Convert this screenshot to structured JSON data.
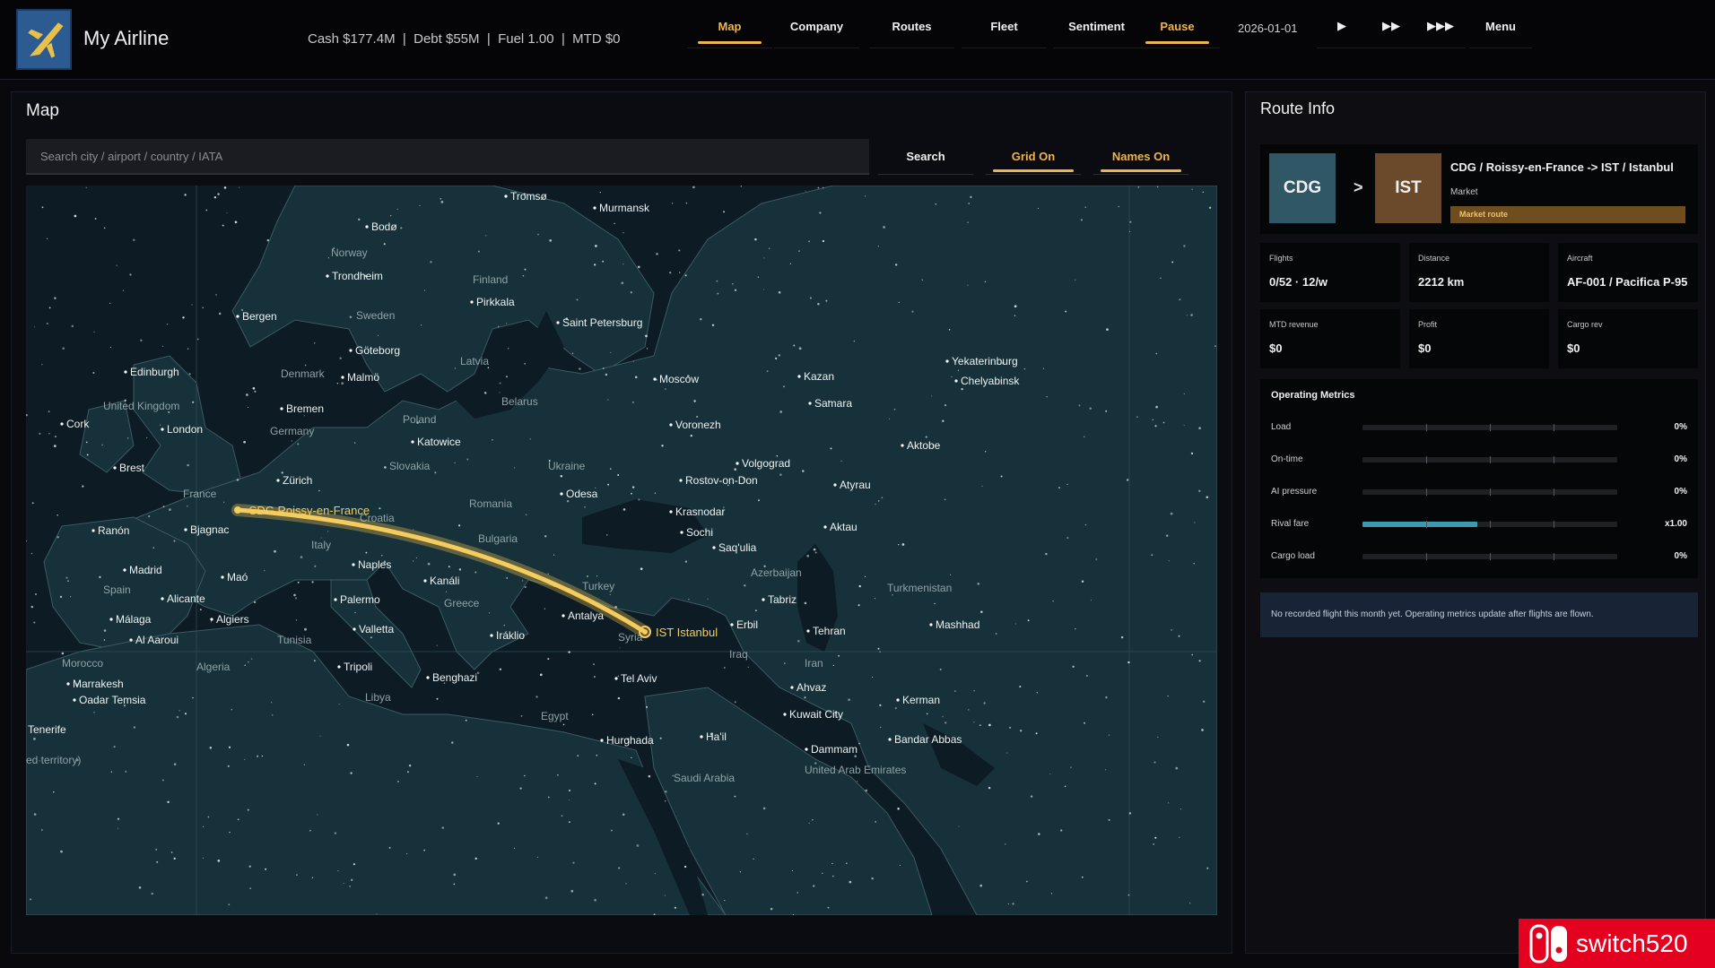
{
  "header": {
    "title": "My Airline",
    "stats": "Cash $177.4M  |  Debt $55M  |  Fuel 1.00  |  MTD $0",
    "nav": [
      {
        "label": "Map",
        "active": true
      },
      {
        "label": "Company",
        "active": false
      },
      {
        "label": "Routes",
        "active": false
      },
      {
        "label": "Fleet",
        "active": false
      },
      {
        "label": "Sentiment",
        "active": false
      },
      {
        "label": "Pause",
        "active": true
      }
    ],
    "date": "2026-01-01",
    "speed": [
      "▶",
      "▶▶",
      "▶▶▶"
    ],
    "menu": "Menu"
  },
  "map": {
    "title": "Map",
    "search_placeholder": "Search city / airport / country / IATA",
    "search_button": "Search",
    "grid_button": "Grid On",
    "names_button": "Names On",
    "cities": [
      "Tromsø",
      "Murmansk",
      "Bodø",
      "Trondheim",
      "Bergen",
      "Pirkkala",
      "Saint Petersburg",
      "Göteborg",
      "Edinburgh",
      "Malmö",
      "Moscow",
      "Kazan",
      "Yekaterinburg",
      "Chelyabinsk",
      "Samara",
      "Cork",
      "London",
      "Bremen",
      "Katowice",
      "Voronezh",
      "Aktobe",
      "Brest",
      "Zürich",
      "Volgograd",
      "Rostov-on-Don",
      "Atyrau",
      "Odesa",
      "Krasnodar",
      "Ranón",
      "Bjagnac",
      "Sochi",
      "Aktau",
      "Madrid",
      "Naples",
      "Saq'ulia",
      "Maó",
      "Kanáli",
      "Alicante",
      "Palermo",
      "Antalya",
      "Tabriz",
      "Málaga",
      "Algiers",
      "Valletta",
      "Erbil",
      "Tehran",
      "Mashhad",
      "Al Aaroui",
      "Iráklio",
      "Marrakesh",
      "Tripoli",
      "Benghazi",
      "Tel Aviv",
      "Ahvaz",
      "Oadar Temsia",
      "Kerman",
      "Kuwait City",
      "Tenerife",
      "Hurghada",
      "Ha'il",
      "Dammam",
      "Bandar Abbas"
    ],
    "countries": [
      "Norway",
      "Finland",
      "Sweden",
      "Denmark",
      "Latvia",
      "United Kingdom",
      "Belarus",
      "Poland",
      "Germany",
      "Slovakia",
      "Ukraine",
      "France",
      "Romania",
      "Croatia",
      "Bulgaria",
      "Italy",
      "Spain",
      "Turkey",
      "Greece",
      "Azerbaijan",
      "Turkmenistan",
      "Tunisia",
      "Syria",
      "Iraq",
      "Iran",
      "Morocco",
      "Algeria",
      "Libya",
      "Egypt",
      "Saudi Arabia",
      "United Arab Emirates",
      "ed territory)"
    ],
    "route_origin_label": "CDG  Roissy-en-France",
    "route_dest_label": "IST  Istanbul"
  },
  "route_info": {
    "title": "Route Info",
    "from_code": "CDG",
    "to_code": "IST",
    "arrow": ">",
    "name": "CDG / Roissy-en-France -> IST / Istanbul",
    "sub": "Market",
    "badge": "Market route",
    "stats": [
      {
        "label": "Flights",
        "value": "0/52 · 12/w"
      },
      {
        "label": "Distance",
        "value": "2212 km"
      },
      {
        "label": "Aircraft",
        "value": "AF-001 / Pacifica P-95"
      },
      {
        "label": "MTD revenue",
        "value": "$0"
      },
      {
        "label": "Profit",
        "value": "$0"
      },
      {
        "label": "Cargo rev",
        "value": "$0"
      }
    ],
    "metrics_title": "Operating Metrics",
    "metrics": [
      {
        "label": "Load",
        "value": "0%",
        "level": 0
      },
      {
        "label": "On-time",
        "value": "0%",
        "level": 0
      },
      {
        "label": "AI pressure",
        "value": "0%",
        "level": 0
      },
      {
        "label": "Rival fare",
        "value": "x1.00",
        "level": 0.45
      },
      {
        "label": "Cargo load",
        "value": "0%",
        "level": 0
      }
    ],
    "notice": "No recorded flight this month yet. Operating metrics update after flights are flown."
  },
  "watermark": "switch520",
  "colors": {
    "accent": "#f0b54a",
    "water": "#0c1c26",
    "land": "#18333a",
    "route": "#f2c14e",
    "bar": "#3a9ab0"
  }
}
